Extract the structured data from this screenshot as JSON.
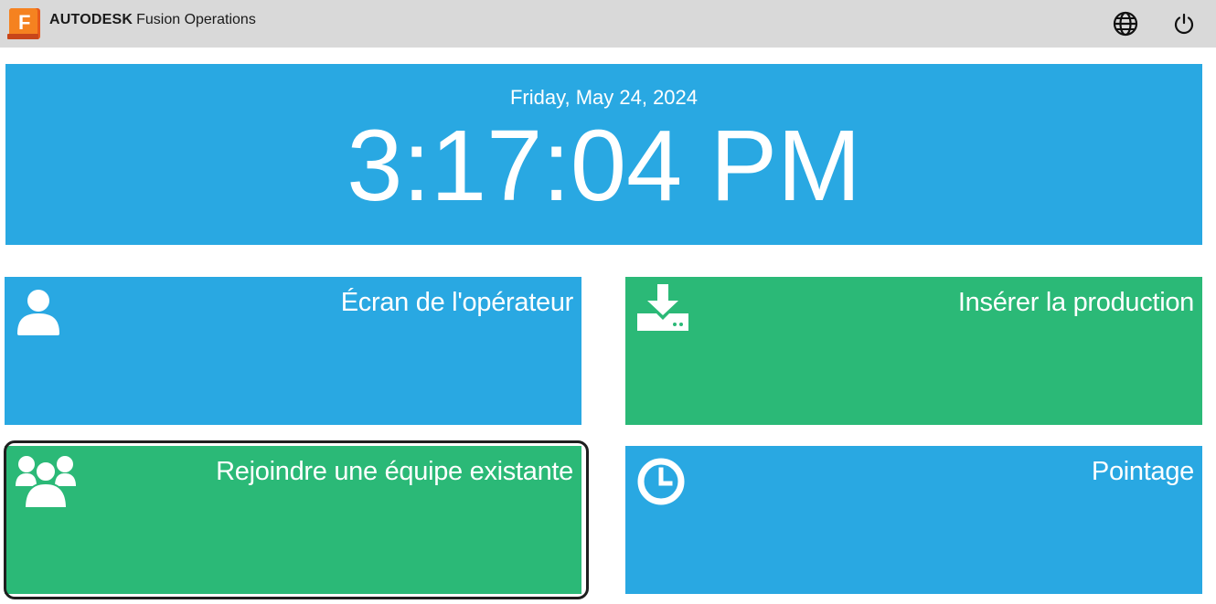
{
  "header": {
    "logo_letter": "F",
    "brand_bold": "AUTODESK",
    "brand_product": "Fusion Operations",
    "icons": [
      "globe-icon",
      "power-icon"
    ]
  },
  "clock": {
    "date": "Friday, May 24, 2024",
    "time": "3:17:04 PM"
  },
  "tiles": [
    {
      "label": "Écran de l'opérateur",
      "icon": "user-icon",
      "color": "#29a8e2"
    },
    {
      "label": "Insérer la production",
      "icon": "download-tray-icon",
      "color": "#2bb977"
    },
    {
      "label": "Rejoindre une équipe existante",
      "icon": "users-group-icon",
      "color": "#2bb977"
    },
    {
      "label": "Pointage",
      "icon": "clock-icon",
      "color": "#29a8e2"
    }
  ],
  "colors": {
    "header_bg": "#d9d9d9",
    "blue": "#29a8e2",
    "green": "#2bb977",
    "logo_orange": "#f26b1d"
  }
}
